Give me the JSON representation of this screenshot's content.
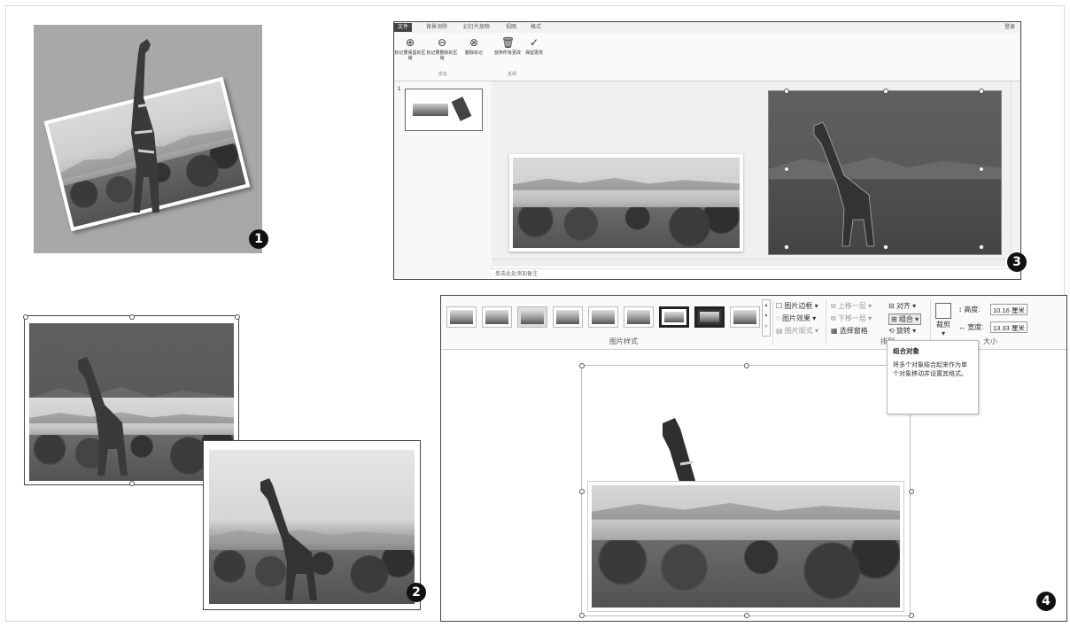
{
  "steps": [
    "1",
    "2",
    "3",
    "4"
  ],
  "panel3": {
    "tabs": [
      "文件",
      "背景消除",
      "幻灯片放映",
      "视图",
      "格式"
    ],
    "right_label": "登录",
    "buttons": [
      {
        "label": "标记要保留的区域",
        "icon": "plus-circle-icon"
      },
      {
        "label": "标记要删除的区域",
        "icon": "minus-circle-icon"
      },
      {
        "label": "删除标记",
        "icon": "delete-mark-icon"
      },
      {
        "label": "放弃所有更改",
        "icon": "trash-icon"
      },
      {
        "label": "保留更改",
        "icon": "check-icon"
      }
    ],
    "group_labels": [
      "优化",
      "关闭"
    ],
    "slide_number": "1",
    "notes_placeholder": "单击此处添加备注"
  },
  "panel4": {
    "picture_style_group": "图片样式",
    "picture_border": "图片边框",
    "picture_effects": "图片效果",
    "picture_layout": "图片版式",
    "bring_forward": "上移一层",
    "send_backward": "下移一层",
    "selection_pane": "选择窗格",
    "align": "对齐",
    "group": "组合",
    "rotate": "旋转",
    "arrange_group": "排列",
    "crop": "裁剪",
    "height_label": "高度:",
    "height_value": "10.16 厘米",
    "width_label": "宽度:",
    "width_value": "13.33 厘米",
    "size_group": "大小",
    "tooltip_title": "组合对象",
    "tooltip_body": "将多个对象结合起来作为单个对象移动并设置其格式。"
  }
}
